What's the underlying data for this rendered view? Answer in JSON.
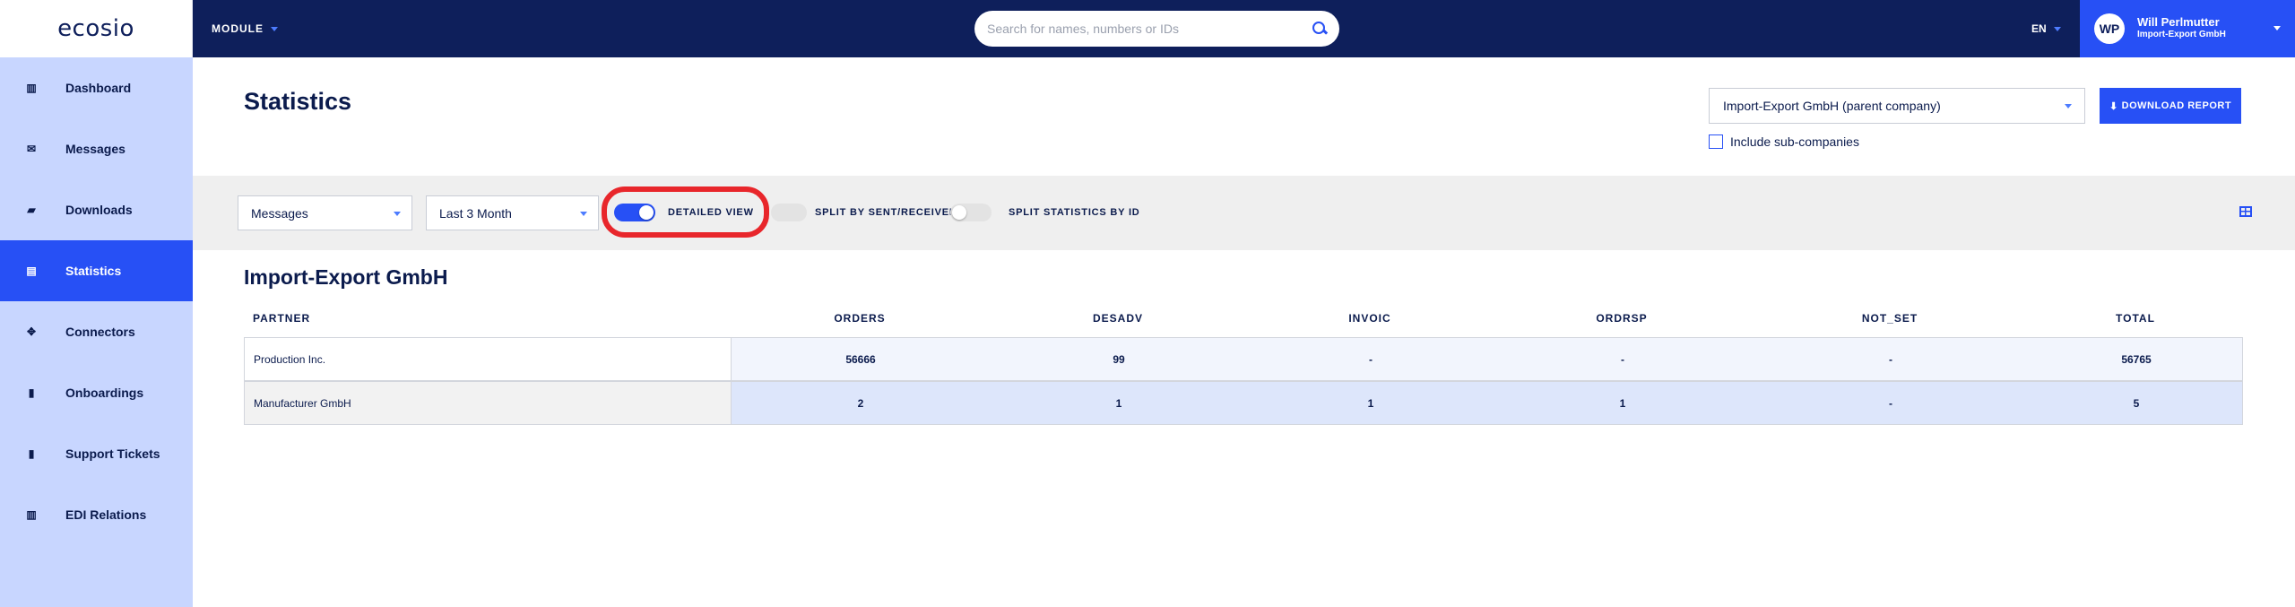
{
  "header": {
    "logo_text": "ecosio",
    "module_label": "MODULE",
    "search_placeholder": "Search for names, numbers or IDs",
    "language": "EN",
    "user": {
      "initials": "WP",
      "name": "Will Perlmutter",
      "company": "Import-Export GmbH"
    }
  },
  "sidebar": {
    "items": [
      {
        "label": "Dashboard",
        "icon": "bar-chart-icon",
        "glyph": "▥",
        "active": false
      },
      {
        "label": "Messages",
        "icon": "envelope-icon",
        "glyph": "✉",
        "active": false
      },
      {
        "label": "Downloads",
        "icon": "folder-open-icon",
        "glyph": "▰",
        "active": false
      },
      {
        "label": "Statistics",
        "icon": "list-alt-icon",
        "glyph": "▤",
        "active": true
      },
      {
        "label": "Connectors",
        "icon": "connectors-icon",
        "glyph": "✥",
        "active": false
      },
      {
        "label": "Onboardings",
        "icon": "clipboard-icon",
        "glyph": "▮",
        "active": false
      },
      {
        "label": "Support Tickets",
        "icon": "clipboard-list-icon",
        "glyph": "▮",
        "active": false
      },
      {
        "label": "EDI Relations",
        "icon": "bar-chart-icon",
        "glyph": "▥",
        "active": false
      }
    ]
  },
  "main": {
    "title": "Statistics",
    "company_select": "Import-Export GmbH (parent company)",
    "download_label": "DOWNLOAD REPORT",
    "include_subcompanies_label": "Include sub-companies",
    "include_subcompanies_checked": false
  },
  "filters": {
    "type_select": "Messages",
    "period_select": "Last 3 Month",
    "toggles": [
      {
        "label": "DETAILED VIEW",
        "on": true
      },
      {
        "label": "SPLIT BY SENT/RECEIVED",
        "on": false
      },
      {
        "label": "SPLIT STATISTICS BY ID",
        "on": false
      }
    ]
  },
  "table": {
    "title": "Import-Export GmbH",
    "columns": [
      "PARTNER",
      "ORDERS",
      "DESADV",
      "INVOIC",
      "ORDRSP",
      "NOT_SET",
      "TOTAL"
    ],
    "rows": [
      {
        "partner": "Production Inc.",
        "values": [
          "56666",
          "99",
          "-",
          "-",
          "-",
          "56765"
        ]
      },
      {
        "partner": "Manufacturer GmbH",
        "values": [
          "2",
          "1",
          "1",
          "1",
          "-",
          "5"
        ]
      }
    ]
  },
  "colors": {
    "navy": "#0e1f5b",
    "accent_blue": "#2750f5",
    "sidebar_bg": "#c8d6ff",
    "highlight_red": "#e8262b",
    "row1_bg": "#f2f5fd",
    "row2_bg": "#dde6fb",
    "partner_row2_bg": "#f2f2f2"
  }
}
